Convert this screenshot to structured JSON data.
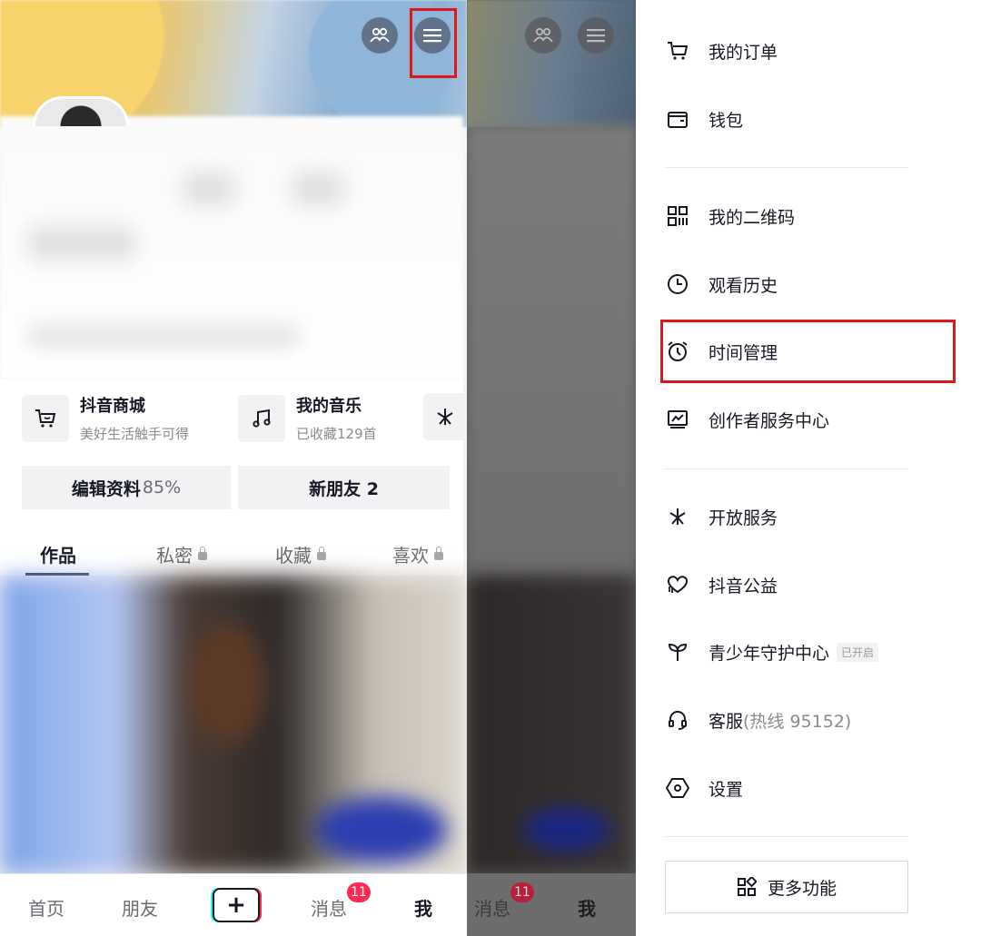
{
  "left": {
    "quick_entries": [
      {
        "title": "抖音商城",
        "subtitle": "美好生活触手可得",
        "icon": "cart-icon"
      },
      {
        "title": "我的音乐",
        "subtitle": "已收藏129首",
        "icon": "music-note-icon"
      }
    ],
    "edit_profile": {
      "label": "编辑资料",
      "percent": "85%"
    },
    "new_friends": "新朋友 2",
    "tabs": [
      {
        "label": "作品"
      },
      {
        "label": "私密"
      },
      {
        "label": "收藏"
      },
      {
        "label": "喜欢"
      }
    ],
    "nav": {
      "home": "首页",
      "friends": "朋友",
      "messages": "消息",
      "messages_badge": "11",
      "me": "我"
    }
  },
  "middle": {
    "messages": "消息",
    "messages_badge": "11",
    "me": "我"
  },
  "drawer": {
    "items": [
      {
        "label": "我的订单",
        "icon": "cart-icon"
      },
      {
        "label": "钱包",
        "icon": "wallet-icon"
      },
      {
        "label": "我的二维码",
        "icon": "qr-code-icon"
      },
      {
        "label": "观看历史",
        "icon": "clock-icon"
      },
      {
        "label": "时间管理",
        "icon": "alarm-clock-icon"
      },
      {
        "label": "创作者服务中心",
        "icon": "chart-monitor-icon"
      },
      {
        "label": "开放服务",
        "icon": "spark-icon"
      },
      {
        "label": "抖音公益",
        "icon": "heart-hands-icon"
      },
      {
        "label": "青少年守护中心",
        "icon": "sprout-icon",
        "tag": "已开启"
      },
      {
        "label": "客服",
        "hotline": "(热线 95152)",
        "icon": "headset-icon"
      },
      {
        "label": "设置",
        "icon": "settings-hexagon-icon"
      }
    ],
    "more_button": "更多功能"
  },
  "colors": {
    "highlight": "#e0181b",
    "badge": "#fe2c55",
    "text": "#161823"
  }
}
